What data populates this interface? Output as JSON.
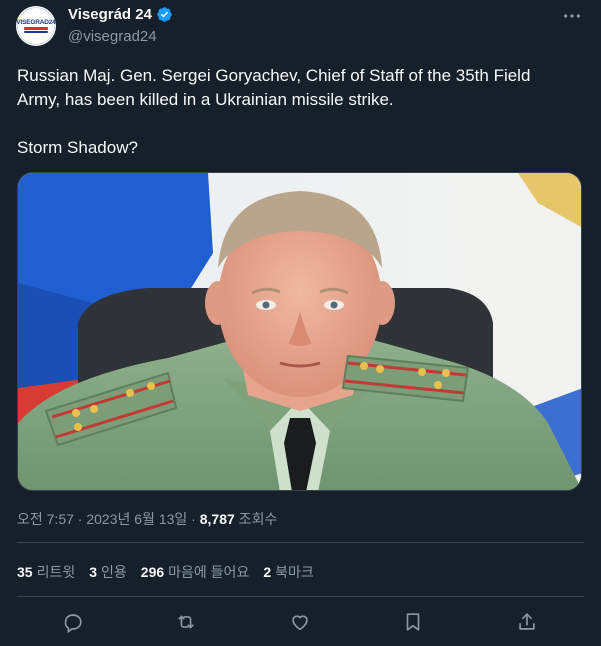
{
  "account": {
    "display_name": "Visegrád 24",
    "handle": "@visegrad24",
    "avatar_text": "VISEGRAD24"
  },
  "tweet": {
    "line1": "Russian Maj. Gen. Sergei Goryachev, Chief of Staff of the 35th Field Army, has been killed in a Ukrainian missile strike.",
    "line2": "Storm Shadow?"
  },
  "meta": {
    "time": "오전 7:57",
    "sep1": " · ",
    "date": "2023년 6월 13일",
    "sep2": " · ",
    "views_count": "8,787",
    "views_label": " 조회수"
  },
  "stats": {
    "retweets_count": "35",
    "retweets_label": "리트윗",
    "quotes_count": "3",
    "quotes_label": "인용",
    "likes_count": "296",
    "likes_label": "마음에 들어요",
    "bookmarks_count": "2",
    "bookmarks_label": "북마크"
  },
  "icons": {
    "verified": "verified-badge-icon",
    "more": "more-options-icon",
    "reply": "reply-icon",
    "retweet": "retweet-icon",
    "like": "heart-icon",
    "bookmark": "bookmark-icon",
    "share": "share-icon"
  },
  "colors": {
    "background": "#15202b",
    "text": "#f7f9f9",
    "secondary": "#8b98a5",
    "verified": "#1d9bf0",
    "divider": "#38444d"
  }
}
